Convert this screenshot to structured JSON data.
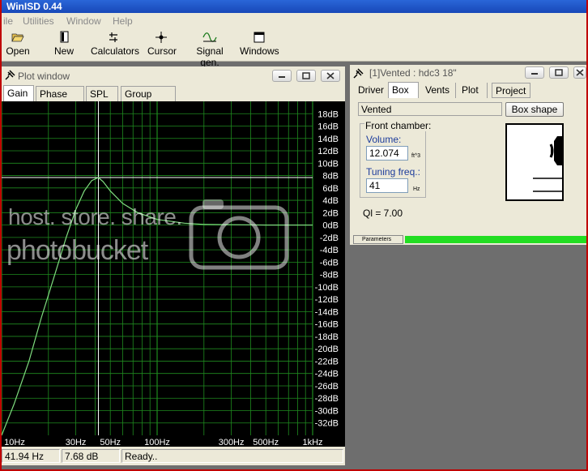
{
  "app": {
    "title": "WinISD 0.44"
  },
  "menu": [
    "ile",
    "Utilities",
    "Window",
    "Help"
  ],
  "toolbar": [
    {
      "label": "Open",
      "icon": "folder-open-icon"
    },
    {
      "label": "New",
      "icon": "new-document-icon"
    },
    {
      "label": "Calculators",
      "icon": "calculator-icon"
    },
    {
      "label": "Cursor",
      "icon": "cursor-icon"
    },
    {
      "label": "Signal gen.",
      "icon": "signal-generator-icon"
    },
    {
      "label": "Windows",
      "icon": "windows-icon"
    }
  ],
  "plot_window": {
    "title": "Plot window",
    "tabs": [
      "Gain",
      "Phase plot",
      "SPL",
      "Group delay"
    ],
    "active_tab": "Gain",
    "status": {
      "frequency": "41.94 Hz",
      "gain": "7.68 dB",
      "state": "Ready.."
    }
  },
  "chart_data": {
    "type": "line",
    "x_scale": "log",
    "xlim": [
      10,
      1000
    ],
    "ylim": [
      -34,
      20
    ],
    "x_ticks": [
      {
        "value": 10,
        "label": "10Hz"
      },
      {
        "value": 30,
        "label": "30Hz"
      },
      {
        "value": 50,
        "label": "50Hz"
      },
      {
        "value": 100,
        "label": "100Hz"
      },
      {
        "value": 300,
        "label": "300Hz"
      },
      {
        "value": 500,
        "label": "500Hz"
      },
      {
        "value": 1000,
        "label": "1kHz"
      }
    ],
    "y_ticks": [
      {
        "value": 18,
        "label": "18dB"
      },
      {
        "value": 16,
        "label": "16dB"
      },
      {
        "value": 14,
        "label": "14dB"
      },
      {
        "value": 12,
        "label": "12dB"
      },
      {
        "value": 10,
        "label": "10dB"
      },
      {
        "value": 8,
        "label": "8dB"
      },
      {
        "value": 6,
        "label": "6dB"
      },
      {
        "value": 4,
        "label": "4dB"
      },
      {
        "value": 2,
        "label": "2dB"
      },
      {
        "value": 0,
        "label": "0dB"
      },
      {
        "value": -2,
        "label": "-2dB"
      },
      {
        "value": -4,
        "label": "-4dB"
      },
      {
        "value": -6,
        "label": "-6dB"
      },
      {
        "value": -8,
        "label": "-8dB"
      },
      {
        "value": -10,
        "label": "-10dB"
      },
      {
        "value": -12,
        "label": "-12dB"
      },
      {
        "value": -14,
        "label": "-14dB"
      },
      {
        "value": -16,
        "label": "-16dB"
      },
      {
        "value": -18,
        "label": "-18dB"
      },
      {
        "value": -20,
        "label": "-20dB"
      },
      {
        "value": -22,
        "label": "-22dB"
      },
      {
        "value": -24,
        "label": "-24dB"
      },
      {
        "value": -26,
        "label": "-26dB"
      },
      {
        "value": -28,
        "label": "-28dB"
      },
      {
        "value": -30,
        "label": "-30dB"
      },
      {
        "value": -32,
        "label": "-32dB"
      }
    ],
    "series": [
      {
        "x": [
          10,
          12,
          15,
          18,
          22,
          26,
          30,
          34,
          38,
          41.94,
          45,
          50,
          60,
          75,
          100,
          150,
          200,
          300,
          500,
          1000
        ],
        "y": [
          -34,
          -29,
          -22,
          -15,
          -8,
          -2,
          2.5,
          5.5,
          7.2,
          7.68,
          7.0,
          5.5,
          3.5,
          2.0,
          0.9,
          0.3,
          0.1,
          0.05,
          0.0,
          0.0
        ]
      }
    ],
    "cursor": {
      "x": 41.94,
      "y": 7.68
    },
    "grid": true
  },
  "vented_window": {
    "title": "[1]Vented : hdc3 18\"",
    "tabs": [
      "Driver",
      "Box",
      "Vents",
      "Plot",
      "Project"
    ],
    "active_tab": "Box",
    "box_type": "Vented",
    "box_shape_label": "Box shape",
    "group_label": "Front chamber:",
    "volume_label": "Volume:",
    "volume_value": "12.074",
    "volume_unit": "ft^3",
    "tuning_label": "Tuning freq.:",
    "tuning_value": "41",
    "tuning_unit": "Hz",
    "ql": "Ql = 7.00",
    "params_label": "Parameters"
  },
  "watermark": {
    "text": "host. store. share.",
    "brand": "photobucket"
  },
  "colors": {
    "curve": "#7fdc7f",
    "grid": "#1f8a1f",
    "progress": "#22dd22"
  }
}
